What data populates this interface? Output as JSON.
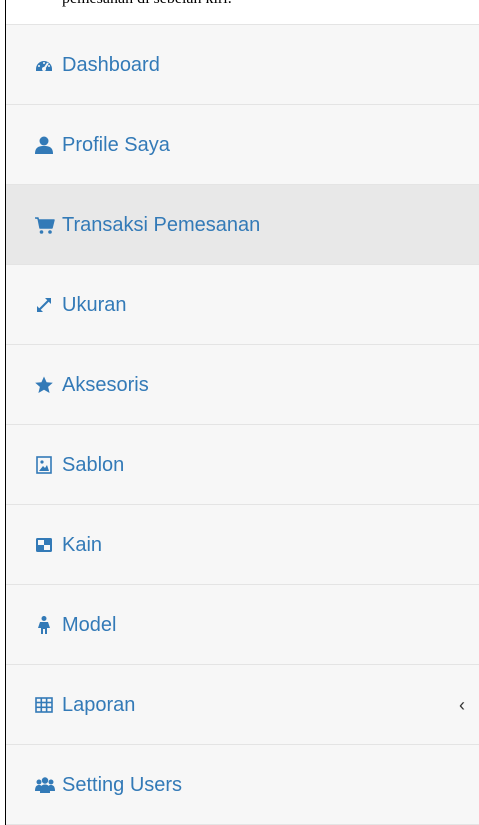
{
  "caption": "pemesanan di sebelah kiri.",
  "colors": {
    "link": "#337ab7",
    "item_bg": "#f7f7f7",
    "active_bg": "#e8e8e8",
    "divider": "#e4e4e4"
  },
  "menu": {
    "items": [
      {
        "label": "Dashboard",
        "icon": "dashboard-icon"
      },
      {
        "label": "Profile Saya",
        "icon": "user-icon"
      },
      {
        "label": "Transaksi Pemesanan",
        "icon": "shopping-cart-icon",
        "active": true
      },
      {
        "label": "Ukuran",
        "icon": "resize-icon"
      },
      {
        "label": "Aksesoris",
        "icon": "star-icon"
      },
      {
        "label": "Sablon",
        "icon": "image-file-icon"
      },
      {
        "label": "Kain",
        "icon": "window-icon"
      },
      {
        "label": "Model",
        "icon": "female-figure-icon"
      },
      {
        "label": "Laporan",
        "icon": "table-icon",
        "caret": "‹"
      },
      {
        "label": "Setting Users",
        "icon": "users-icon"
      }
    ]
  }
}
